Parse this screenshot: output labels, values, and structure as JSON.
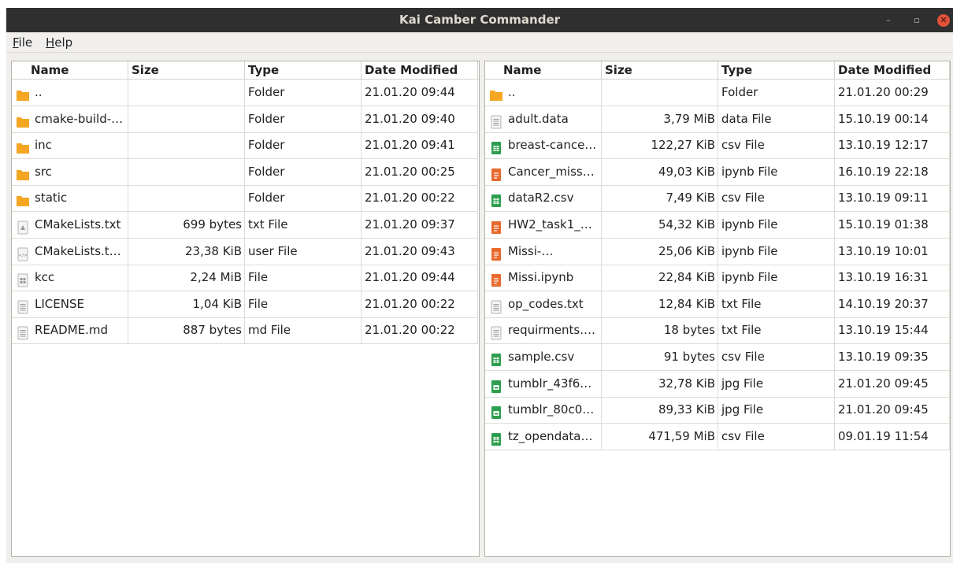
{
  "window": {
    "title": "Kai Camber Commander",
    "controls": {
      "minimize": "–",
      "maximize": "▫",
      "close": "✕"
    }
  },
  "menu": {
    "file": {
      "key": "F",
      "rest": "ile"
    },
    "help": {
      "key": "H",
      "rest": "elp"
    }
  },
  "colors": {
    "titlebar": "#2f2f2f",
    "folder": "#f5a623",
    "csv": "#2e9e4f",
    "ipynb": "#e86a2e",
    "text_file": "#a8a8a8",
    "close_button": "#e2513b"
  },
  "columns": [
    "Name",
    "Size",
    "Type",
    "Date Modified"
  ],
  "left_panel": {
    "rows": [
      {
        "name": "..",
        "size": "",
        "type": "Folder",
        "date": "21.01.20 09:44",
        "icon": "folder-icon"
      },
      {
        "name": "cmake-build-…",
        "size": "",
        "type": "Folder",
        "date": "21.01.20 09:40",
        "icon": "folder-icon"
      },
      {
        "name": "inc",
        "size": "",
        "type": "Folder",
        "date": "21.01.20 09:41",
        "icon": "folder-icon"
      },
      {
        "name": "src",
        "size": "",
        "type": "Folder",
        "date": "21.01.20 00:25",
        "icon": "folder-icon"
      },
      {
        "name": "static",
        "size": "",
        "type": "Folder",
        "date": "21.01.20 00:22",
        "icon": "folder-icon"
      },
      {
        "name": "CMakeLists.txt",
        "size": "699 bytes",
        "type": "txt File",
        "date": "21.01.20 09:37",
        "icon": "script-file-icon"
      },
      {
        "name": "CMakeLists.t…",
        "size": "23,38 KiB",
        "type": "user File",
        "date": "21.01.20 09:43",
        "icon": "code-file-icon"
      },
      {
        "name": "kcc",
        "size": "2,24 MiB",
        "type": "File",
        "date": "21.01.20 09:44",
        "icon": "binary-file-icon"
      },
      {
        "name": "LICENSE",
        "size": "1,04 KiB",
        "type": "File",
        "date": "21.01.20 00:22",
        "icon": "text-file-icon"
      },
      {
        "name": "README.md",
        "size": "887 bytes",
        "type": "md File",
        "date": "21.01.20 00:22",
        "icon": "text-file-icon"
      }
    ]
  },
  "right_panel": {
    "rows": [
      {
        "name": "..",
        "size": "",
        "type": "Folder",
        "date": "21.01.20 00:29",
        "icon": "folder-icon"
      },
      {
        "name": "adult.data",
        "size": "3,79 MiB",
        "type": "data File",
        "date": "15.10.19 00:14",
        "icon": "text-file-icon"
      },
      {
        "name": "breast-cance…",
        "size": "122,27 KiB",
        "type": "csv File",
        "date": "13.10.19 12:17",
        "icon": "spreadsheet-icon"
      },
      {
        "name": "Cancer_miss…",
        "size": "49,03 KiB",
        "type": "ipynb File",
        "date": "16.10.19 22:18",
        "icon": "notebook-icon"
      },
      {
        "name": "dataR2.csv",
        "size": "7,49 KiB",
        "type": "csv File",
        "date": "13.10.19 09:11",
        "icon": "spreadsheet-icon"
      },
      {
        "name": "HW2_task1_…",
        "size": "54,32 KiB",
        "type": "ipynb File",
        "date": "15.10.19 01:38",
        "icon": "notebook-icon"
      },
      {
        "name": "Missi-…",
        "size": "25,06 KiB",
        "type": "ipynb File",
        "date": "13.10.19 10:01",
        "icon": "notebook-icon"
      },
      {
        "name": "Missi.ipynb",
        "size": "22,84 KiB",
        "type": "ipynb File",
        "date": "13.10.19 16:31",
        "icon": "notebook-icon"
      },
      {
        "name": "op_codes.txt",
        "size": "12,84 KiB",
        "type": "txt File",
        "date": "14.10.19 20:37",
        "icon": "text-file-icon"
      },
      {
        "name": "requirments.…",
        "size": "18 bytes",
        "type": "txt File",
        "date": "13.10.19 15:44",
        "icon": "text-file-icon"
      },
      {
        "name": "sample.csv",
        "size": "91 bytes",
        "type": "csv File",
        "date": "13.10.19 09:35",
        "icon": "spreadsheet-icon"
      },
      {
        "name": "tumblr_43f6…",
        "size": "32,78 KiB",
        "type": "jpg File",
        "date": "21.01.20 09:45",
        "icon": "image-file-icon"
      },
      {
        "name": "tumblr_80c0…",
        "size": "89,33 KiB",
        "type": "jpg File",
        "date": "21.01.20 09:45",
        "icon": "image-file-icon"
      },
      {
        "name": "tz_opendata…",
        "size": "471,59 MiB",
        "type": "csv File",
        "date": "09.01.19 11:54",
        "icon": "spreadsheet-icon"
      }
    ]
  }
}
